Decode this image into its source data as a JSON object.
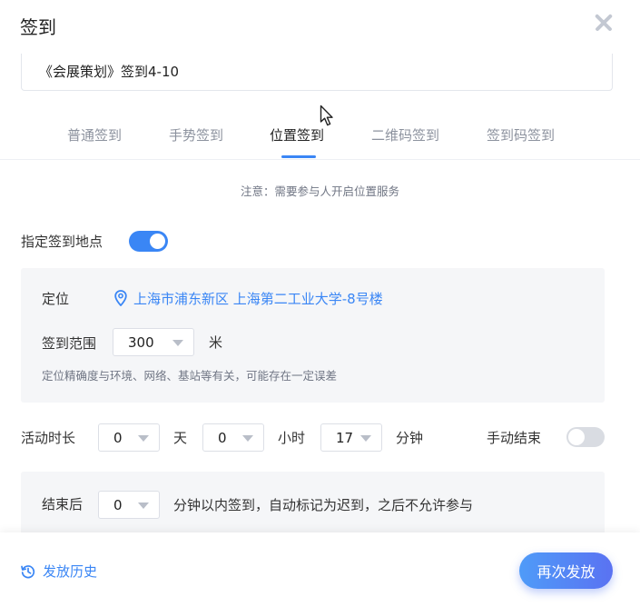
{
  "dialog": {
    "title": "签到"
  },
  "activity": {
    "name": "《会展策划》签到4-10"
  },
  "tabs": [
    {
      "label": "普通签到",
      "active": false
    },
    {
      "label": "手势签到",
      "active": false
    },
    {
      "label": "位置签到",
      "active": true
    },
    {
      "label": "二维码签到",
      "active": false
    },
    {
      "label": "签到码签到",
      "active": false
    }
  ],
  "note": "注意：需要参与人开启位置服务",
  "specify_location": {
    "label": "指定签到地点",
    "enabled": true
  },
  "location": {
    "label": "定位",
    "address": "上海市浦东新区 上海第二工业大学-8号楼",
    "range_label": "签到范围",
    "range_value": "300",
    "range_unit": "米",
    "hint": "定位精确度与环境、网络、基站等有关，可能存在一定误差"
  },
  "duration": {
    "label": "活动时长",
    "days": "0",
    "days_unit": "天",
    "hours": "0",
    "hours_unit": "小时",
    "minutes": "17",
    "minutes_unit": "分钟",
    "manual_end_label": "手动结束",
    "manual_end_enabled": false
  },
  "late": {
    "label": "结束后",
    "minutes": "0",
    "desc": "分钟以内签到，自动标记为迟到，之后不允许参与"
  },
  "footer": {
    "history_label": "发放历史",
    "republish_label": "再次发放"
  },
  "colors": {
    "accent": "#3a86f5",
    "toggle_off": "#d9dce2",
    "panel_bg": "#f5f6f8"
  }
}
